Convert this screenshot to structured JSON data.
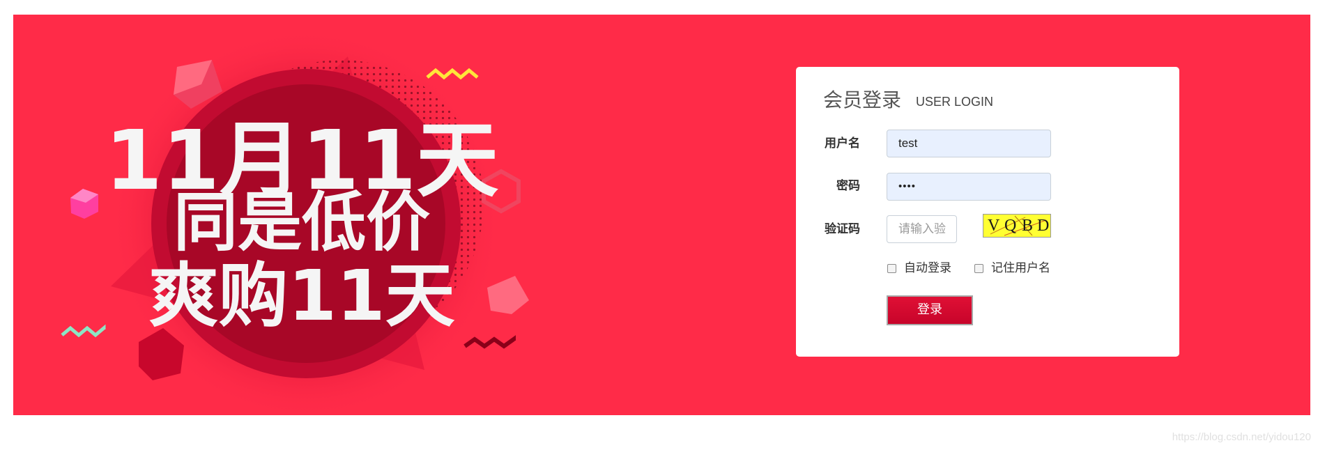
{
  "banner": {
    "bg_color": "#ff2b48",
    "promo_lines": [
      "11月11天",
      "同是低价",
      "爽购11天"
    ]
  },
  "login": {
    "title": "会员登录",
    "subtitle": "USER LOGIN",
    "username_label": "用户名",
    "username_value": "test",
    "password_label": "密码",
    "password_value": "••••",
    "captcha_label": "验证码",
    "captcha_placeholder": "请输入验",
    "captcha_chars": [
      "V",
      "Q",
      "B",
      "D"
    ],
    "auto_login_label": "自动登录",
    "remember_label": "记住用户名",
    "submit_label": "登录",
    "accent_color": "#d4062f"
  },
  "watermark": "https://blog.csdn.net/yidou120"
}
